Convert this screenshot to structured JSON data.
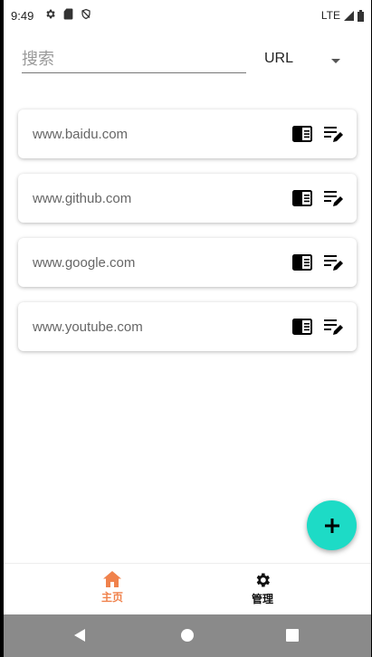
{
  "status": {
    "time": "9:49",
    "network": "LTE"
  },
  "search": {
    "placeholder": "搜索",
    "filter_value": "URL"
  },
  "sites": [
    {
      "label": "www.baidu.com"
    },
    {
      "label": "www.github.com"
    },
    {
      "label": "www.google.com"
    },
    {
      "label": "www.youtube.com"
    }
  ],
  "nav": {
    "home_label": "主页",
    "manage_label": "管理"
  },
  "colors": {
    "accent": "#f0824c",
    "fab": "#1ddbc6"
  },
  "icons": {
    "fab": "plus-icon",
    "home": "home-icon",
    "manage": "gear-icon",
    "card_view": "reader-icon",
    "card_edit": "edit-note-icon"
  }
}
